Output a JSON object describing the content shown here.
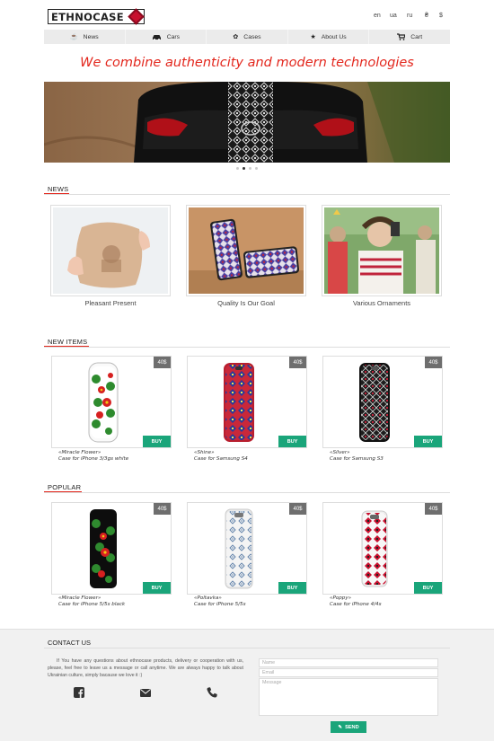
{
  "header": {
    "logo_text": "ETHNOCASE",
    "languages": [
      "en",
      "ua",
      "ru"
    ],
    "currencies": [
      "₴",
      "$"
    ]
  },
  "nav": {
    "items": [
      {
        "label": "News",
        "icon": "news-icon"
      },
      {
        "label": "Cars",
        "icon": "car-icon"
      },
      {
        "label": "Cases",
        "icon": "cases-icon"
      },
      {
        "label": "About Us",
        "icon": "star-icon"
      },
      {
        "label": "Cart",
        "icon": "cart-icon"
      }
    ]
  },
  "tagline": "We combine authenticity and modern technologies",
  "slider": {
    "slides": 4,
    "active_index": 1
  },
  "news": {
    "title": "NEWS",
    "items": [
      {
        "caption": "Pleasant Present"
      },
      {
        "caption": "Quality Is Our Goal"
      },
      {
        "caption": "Various Ornaments"
      }
    ]
  },
  "new_items": {
    "title": "NEW ITEMS",
    "products": [
      {
        "price": "40$",
        "buy": "BUY",
        "name": "«Miracle Flower»",
        "model": "Case for iPhone 3/3gs white"
      },
      {
        "price": "40$",
        "buy": "BUY",
        "name": "«Shine»",
        "model": "Case for Samsung S4"
      },
      {
        "price": "40$",
        "buy": "BUY",
        "name": "«Silver»",
        "model": "Case for Samsung S3"
      }
    ]
  },
  "popular": {
    "title": "POPULAR",
    "products": [
      {
        "price": "40$",
        "buy": "BUY",
        "name": "«Miracle Flower»",
        "model": "Case for iPhone 5/5s black"
      },
      {
        "price": "40$",
        "buy": "BUY",
        "name": "«Poltavka»",
        "model": "Case for iPhone 5/5s"
      },
      {
        "price": "40$",
        "buy": "BUY",
        "name": "«Poppy»",
        "model": "Case for iPhone 4/4s"
      }
    ]
  },
  "contact": {
    "title": "CONTACT US",
    "text": "If You have any questions about ethnocase products, delivery or cooperation with us, please, feel free to leave us a message or call anytime. We are always happy to talk about Ukrainian culture, simply bacause we love it :)",
    "name_placeholder": "Name",
    "email_placeholder": "Email",
    "message_placeholder": "Message",
    "send_label": "SEND"
  },
  "colors": {
    "accent": "#e3261c",
    "buy_green": "#1aa57a",
    "price_grey": "#6e6e6e",
    "nav_bg": "#ebebeb",
    "footer_bg": "#f1f1f1"
  }
}
